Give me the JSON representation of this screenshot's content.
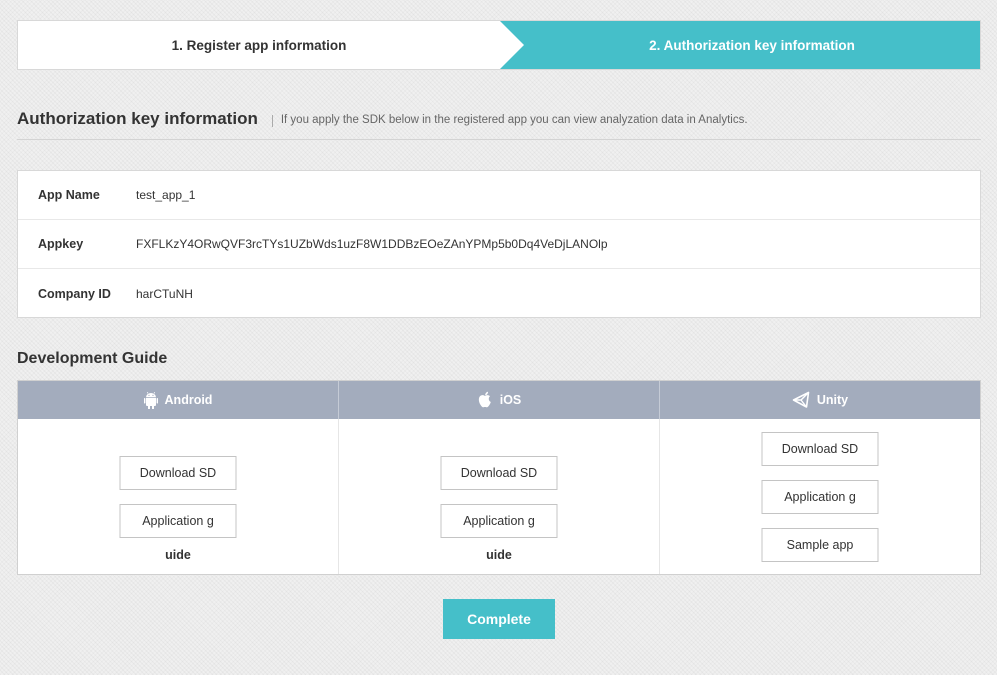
{
  "steps": {
    "step1_label": "1. Register app information",
    "step2_label": "2. Authorization key information"
  },
  "auth_section": {
    "title": "Authorization key information",
    "description": "If you apply the SDK below in the registered app you can view analyzation data in Analytics."
  },
  "info": {
    "app_name_label": "App Name",
    "app_name_value": "test_app_1",
    "appkey_label": "Appkey",
    "appkey_value": "FXFLKzY4ORwQVF3rcTYs1UZbWds1uzF8W1DDBzEOeZAnYPMp5b0Dq4VeDjLANOlp",
    "company_id_label": "Company ID",
    "company_id_value": "harCTuNH"
  },
  "dev_guide": {
    "title": "Development Guide",
    "platforms": {
      "android": {
        "name": "Android",
        "icon": "android-icon",
        "download_label": "Download SD",
        "guide_label": "Application g",
        "overflow_text": "uide"
      },
      "ios": {
        "name": "iOS",
        "icon": "apple-icon",
        "download_label": "Download SD",
        "guide_label": "Application g",
        "overflow_text": "uide"
      },
      "unity": {
        "name": "Unity",
        "icon": "unity-icon",
        "download_label": "Download SD",
        "guide_label": "Application g",
        "sample_label": "Sample app"
      }
    }
  },
  "complete_label": "Complete",
  "colors": {
    "accent": "#45bfc9",
    "guide_header": "#a3acbd"
  }
}
